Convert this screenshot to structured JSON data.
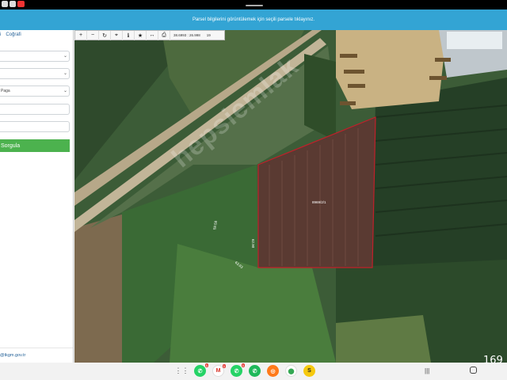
{
  "banner": {
    "text": "Parsel bilgilerini görüntülemek için seçili parsele tıklayınız."
  },
  "sidepanel": {
    "tab_left": "i",
    "tab_right": "Coğrafi",
    "fields": [
      "",
      "",
      "Paga",
      "",
      ""
    ],
    "query_button": "Sorgula",
    "email": "@tkgm.gov.tr"
  },
  "toolbar": {
    "icons": [
      "plus-icon",
      "minus-icon",
      "refresh-icon",
      "crosshair-icon",
      "info-icon",
      "star-icon",
      "measure-icon",
      "print-icon"
    ],
    "coords": "38.6993 : 26.998",
    "zoom": "19"
  },
  "map": {
    "parcel_label": "8969/2/1",
    "edge_labels": [
      "59.58",
      "62.90",
      "63.93"
    ],
    "watermark": "hepsiemlak",
    "parcel_outline_color": "#c0202a"
  },
  "nav": {
    "dock_apps": [
      {
        "name": "whatsapp",
        "color": "#25d366",
        "glyph": "✆",
        "badge": "1"
      },
      {
        "name": "gmail",
        "color": "#ffffff",
        "glyph": "M",
        "badge": "1"
      },
      {
        "name": "whatsapp-2",
        "color": "#25d366",
        "glyph": "✆",
        "badge": "1"
      },
      {
        "name": "phone",
        "color": "#1fb85a",
        "glyph": "✆",
        "badge": ""
      },
      {
        "name": "app-orange",
        "color": "#ff7a1a",
        "glyph": "◎",
        "badge": ""
      },
      {
        "name": "maps",
        "color": "#ffffff",
        "glyph": "⬤",
        "badge": ""
      },
      {
        "name": "app-s",
        "color": "#f6c90e",
        "glyph": "S",
        "badge": ""
      }
    ],
    "overlay_number": "169"
  }
}
